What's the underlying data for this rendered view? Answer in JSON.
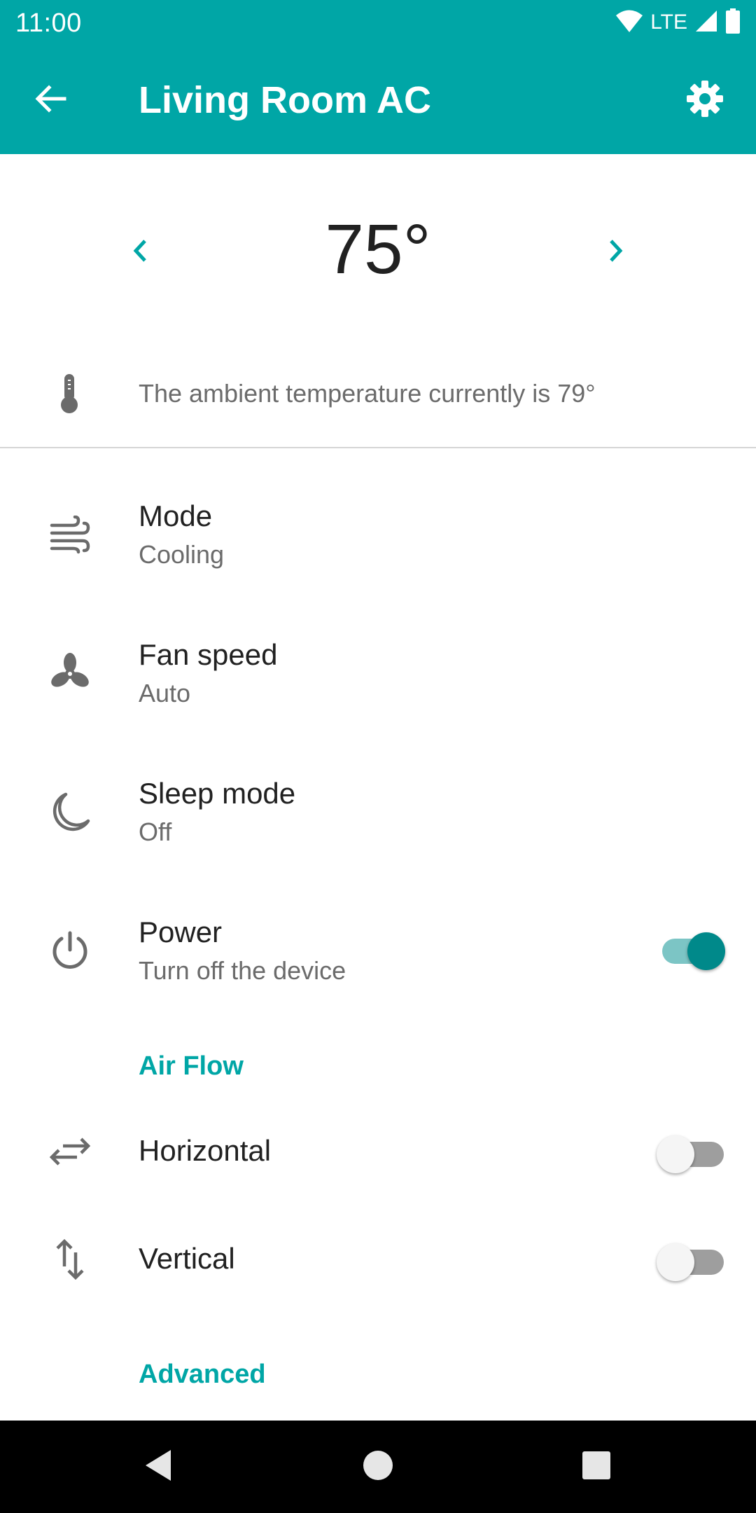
{
  "status_bar": {
    "time": "11:00",
    "network_label": "LTE",
    "icons": [
      "wifi-icon",
      "cellular-signal-icon",
      "battery-icon"
    ]
  },
  "app_bar": {
    "title": "Living Room AC",
    "back_icon": "arrow-back-icon",
    "settings_icon": "gear-icon"
  },
  "temperature": {
    "value": "75°",
    "decrease_icon": "chevron-left-icon",
    "increase_icon": "chevron-right-icon"
  },
  "ambient": {
    "icon": "thermometer-icon",
    "text": "The ambient temperature currently is 79°"
  },
  "settings": {
    "mode": {
      "title": "Mode",
      "value": "Cooling",
      "icon": "wind-icon"
    },
    "fan_speed": {
      "title": "Fan speed",
      "value": "Auto",
      "icon": "fan-icon"
    },
    "sleep_mode": {
      "title": "Sleep mode",
      "value": "Off",
      "icon": "moon-icon"
    },
    "power": {
      "title": "Power",
      "subtitle": "Turn off the device",
      "icon": "power-icon",
      "enabled": true
    }
  },
  "air_flow": {
    "header": "Air Flow",
    "horizontal": {
      "title": "Horizontal",
      "icon": "swap-horizontal-icon",
      "enabled": false
    },
    "vertical": {
      "title": "Vertical",
      "icon": "swap-vertical-icon",
      "enabled": false
    }
  },
  "advanced": {
    "header": "Advanced"
  },
  "nav_bar": {
    "icons": [
      "back-triangle-icon",
      "home-circle-icon",
      "recents-square-icon"
    ]
  },
  "colors": {
    "primary": "#00a6a6",
    "switch_on_thumb": "#00898a",
    "switch_on_track": "#7cc5c5",
    "switch_off_track": "#9e9e9e",
    "icon_gray": "#6b6b6b"
  }
}
